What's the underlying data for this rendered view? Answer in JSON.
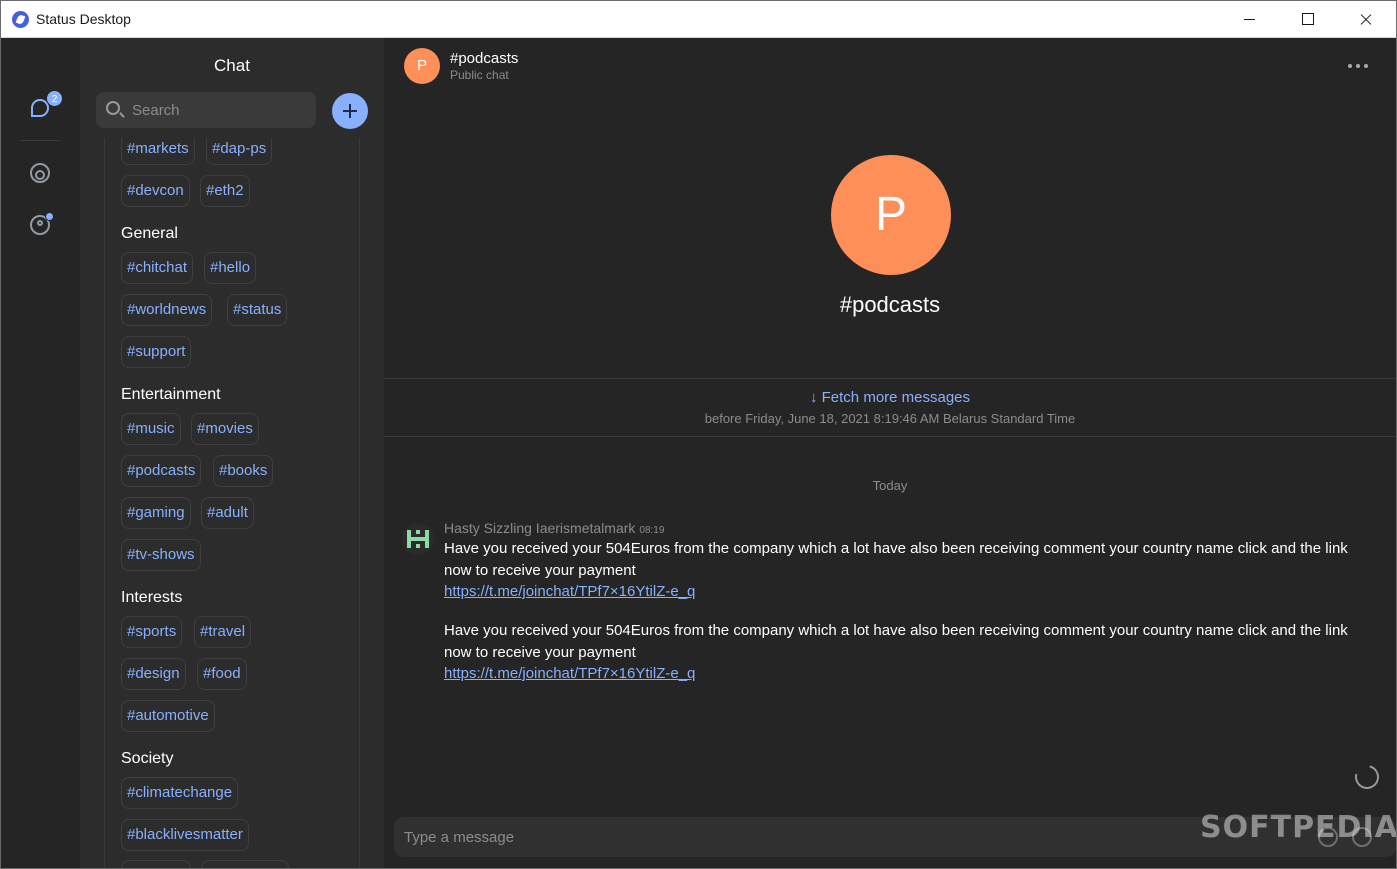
{
  "window": {
    "title": "Status Desktop"
  },
  "rail": {
    "chat_badge": "2"
  },
  "panel": {
    "title": "Chat",
    "search_placeholder": "Search",
    "top_tags": [
      "#markets",
      "#dap-ps",
      "#devcon",
      "#eth2"
    ],
    "categories": [
      {
        "title": "General",
        "tags": [
          "#chitchat",
          "#hello",
          "#worldnews",
          "#status",
          "#support"
        ]
      },
      {
        "title": "Entertainment",
        "tags": [
          "#music",
          "#movies",
          "#podcasts",
          "#books",
          "#gaming",
          "#adult",
          "#tv-shows"
        ]
      },
      {
        "title": "Interests",
        "tags": [
          "#sports",
          "#travel",
          "#design",
          "#food",
          "#automotive"
        ]
      },
      {
        "title": "Society",
        "tags": [
          "#climatechange",
          "#blacklivesmatter"
        ]
      }
    ]
  },
  "chat": {
    "avatar_letter": "P",
    "name": "#podcasts",
    "subtitle": "Public chat",
    "fetch_more": "↓ Fetch more messages",
    "fetch_before": "before Friday, June 18, 2021 8:19:46 AM Belarus Standard Time",
    "day_separator": "Today",
    "message": {
      "author": "Hasty Sizzling Iaerismetalmark",
      "time": "08:19",
      "text1": "Have you received your 504Euros from the company which a lot have also been receiving comment your country name click and the link now to receive your payment",
      "link1": "https://t.me/joinchat/TPf7×16YtilZ-e_q",
      "text2": "Have you received your 504Euros from the company which a lot have also been receiving comment your country name click and the link now to receive your payment",
      "link2": "https://t.me/joinchat/TPf7×16YtilZ-e_q"
    },
    "composer_placeholder": "Type a message"
  },
  "watermark": "SOFTPEDIA",
  "colors": {
    "accent": "#88b0ff",
    "avatar": "#fe8f59",
    "identicon": "#8fd9a8"
  }
}
